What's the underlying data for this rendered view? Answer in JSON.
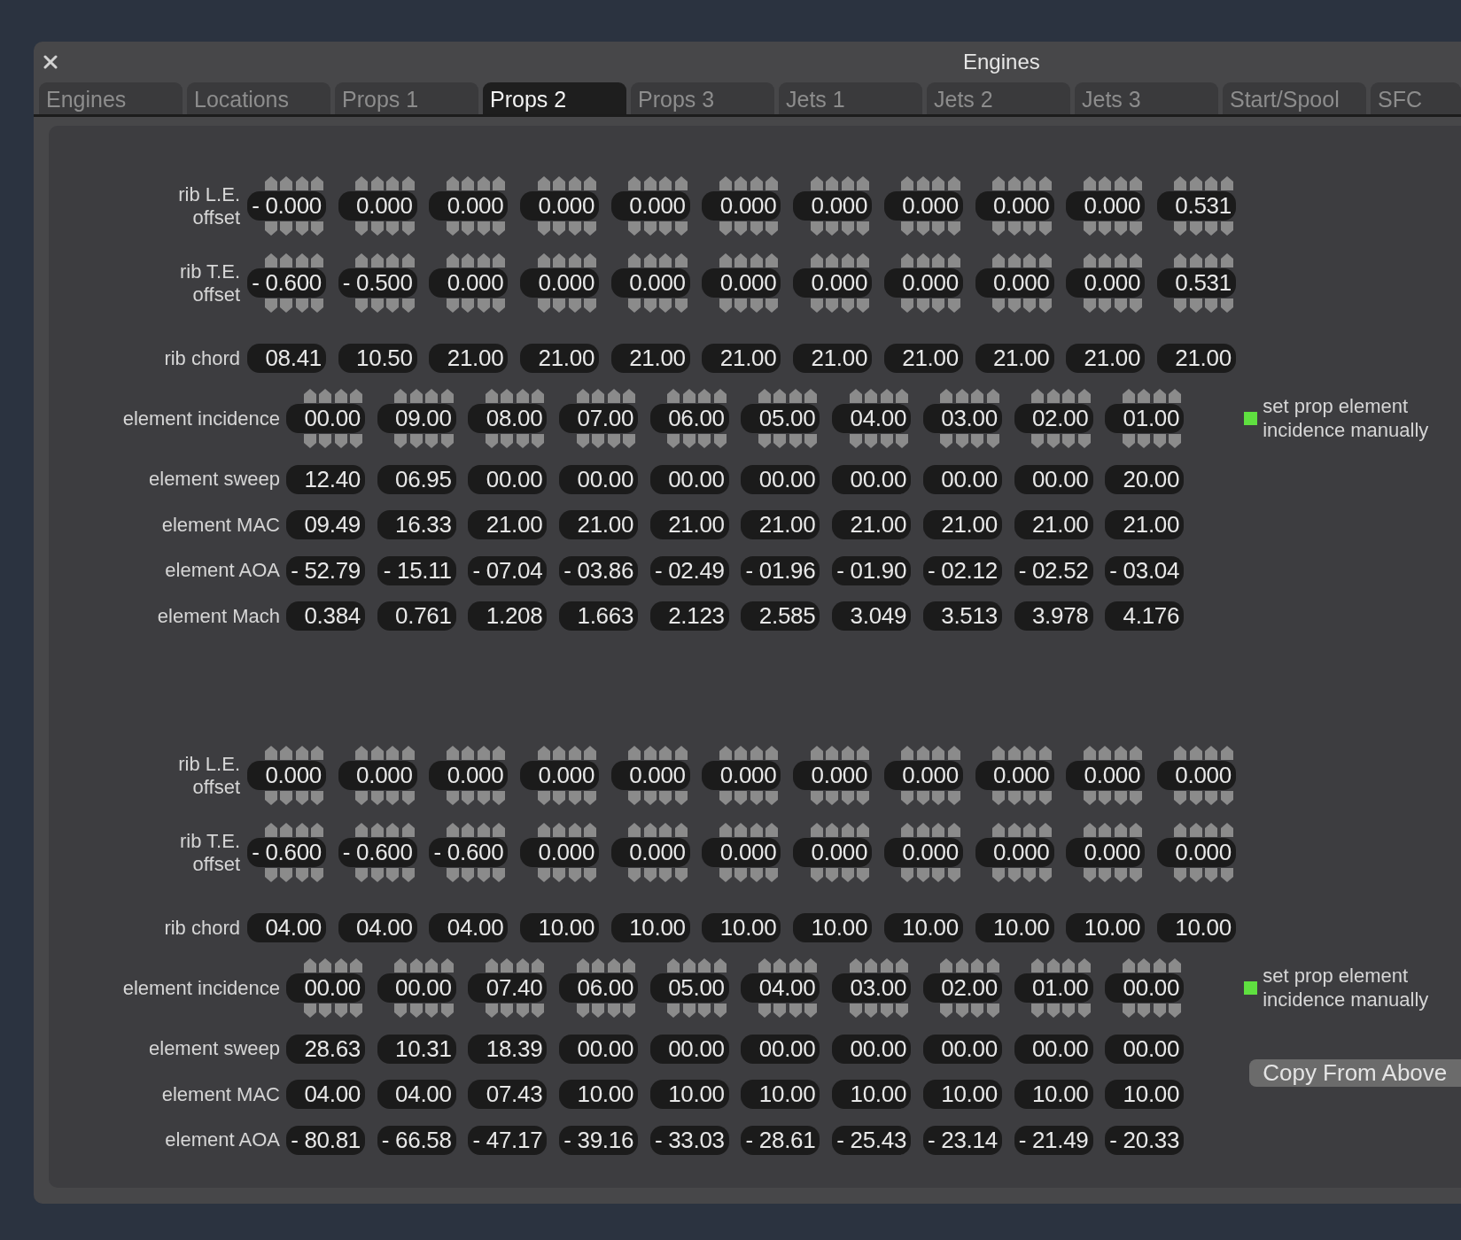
{
  "window": {
    "title": "Engines"
  },
  "tabs": [
    {
      "label": "Engines",
      "selected": false
    },
    {
      "label": "Locations",
      "selected": false
    },
    {
      "label": "Props 1",
      "selected": false
    },
    {
      "label": "Props 2",
      "selected": true
    },
    {
      "label": "Props 3",
      "selected": false
    },
    {
      "label": "Jets 1",
      "selected": false
    },
    {
      "label": "Jets 2",
      "selected": false
    },
    {
      "label": "Jets 3",
      "selected": false
    },
    {
      "label": "Start/Spool",
      "selected": false
    },
    {
      "label": "SFC",
      "selected": false
    }
  ],
  "sections": [
    {
      "ribs": [
        {
          "kind": "spinner",
          "label": "rib L.E. offset",
          "values": [
            "- 0.000",
            "0.000",
            "0.000",
            "0.000",
            "0.000",
            "0.000",
            "0.000",
            "0.000",
            "0.000",
            "0.000",
            "0.531"
          ]
        },
        {
          "kind": "spinner",
          "label": "rib T.E. offset",
          "values": [
            "- 0.600",
            "- 0.500",
            "0.000",
            "0.000",
            "0.000",
            "0.000",
            "0.000",
            "0.000",
            "0.000",
            "0.000",
            "0.531"
          ]
        },
        {
          "kind": "plain",
          "label": "rib chord",
          "values": [
            "08.41",
            "10.50",
            "21.00",
            "21.00",
            "21.00",
            "21.00",
            "21.00",
            "21.00",
            "21.00",
            "21.00",
            "21.00"
          ]
        }
      ],
      "elements": [
        {
          "kind": "spinner",
          "label": "element incidence",
          "values": [
            "00.00",
            "09.00",
            "08.00",
            "07.00",
            "06.00",
            "05.00",
            "04.00",
            "03.00",
            "02.00",
            "01.00"
          ]
        },
        {
          "kind": "plain",
          "label": "element sweep",
          "values": [
            "12.40",
            "06.95",
            "00.00",
            "00.00",
            "00.00",
            "00.00",
            "00.00",
            "00.00",
            "00.00",
            "20.00"
          ]
        },
        {
          "kind": "plain",
          "label": "element MAC",
          "values": [
            "09.49",
            "16.33",
            "21.00",
            "21.00",
            "21.00",
            "21.00",
            "21.00",
            "21.00",
            "21.00",
            "21.00"
          ]
        },
        {
          "kind": "plain",
          "label": "element AOA",
          "values": [
            "- 52.79",
            "- 15.11",
            "- 07.04",
            "- 03.86",
            "- 02.49",
            "- 01.96",
            "- 01.90",
            "- 02.12",
            "- 02.52",
            "- 03.04"
          ]
        },
        {
          "kind": "plain",
          "label": "element Mach",
          "values": [
            "0.384",
            "0.761",
            "1.208",
            "1.663",
            "2.123",
            "2.585",
            "3.049",
            "3.513",
            "3.978",
            "4.176"
          ]
        }
      ],
      "manual_incidence": {
        "label": "set prop element incidence manually",
        "checked": true
      }
    },
    {
      "ribs": [
        {
          "kind": "spinner",
          "label": "rib L.E. offset",
          "values": [
            "0.000",
            "0.000",
            "0.000",
            "0.000",
            "0.000",
            "0.000",
            "0.000",
            "0.000",
            "0.000",
            "0.000",
            "0.000"
          ]
        },
        {
          "kind": "spinner",
          "label": "rib T.E. offset",
          "values": [
            "- 0.600",
            "- 0.600",
            "- 0.600",
            "0.000",
            "0.000",
            "0.000",
            "0.000",
            "0.000",
            "0.000",
            "0.000",
            "0.000"
          ]
        },
        {
          "kind": "plain",
          "label": "rib chord",
          "values": [
            "04.00",
            "04.00",
            "04.00",
            "10.00",
            "10.00",
            "10.00",
            "10.00",
            "10.00",
            "10.00",
            "10.00",
            "10.00"
          ]
        }
      ],
      "elements": [
        {
          "kind": "spinner",
          "label": "element incidence",
          "values": [
            "00.00",
            "00.00",
            "07.40",
            "06.00",
            "05.00",
            "04.00",
            "03.00",
            "02.00",
            "01.00",
            "00.00"
          ]
        },
        {
          "kind": "plain",
          "label": "element sweep",
          "values": [
            "28.63",
            "10.31",
            "18.39",
            "00.00",
            "00.00",
            "00.00",
            "00.00",
            "00.00",
            "00.00",
            "00.00"
          ]
        },
        {
          "kind": "plain",
          "label": "element MAC",
          "values": [
            "04.00",
            "04.00",
            "07.43",
            "10.00",
            "10.00",
            "10.00",
            "10.00",
            "10.00",
            "10.00",
            "10.00"
          ]
        },
        {
          "kind": "plain",
          "label": "element AOA",
          "values": [
            "- 80.81",
            "- 66.58",
            "- 47.17",
            "- 39.16",
            "- 33.03",
            "- 28.61",
            "- 25.43",
            "- 23.14",
            "- 21.49",
            "- 20.33"
          ]
        }
      ],
      "manual_incidence": {
        "label": "set prop element incidence manually",
        "checked": true
      },
      "copy_button": "Copy From Above"
    }
  ]
}
